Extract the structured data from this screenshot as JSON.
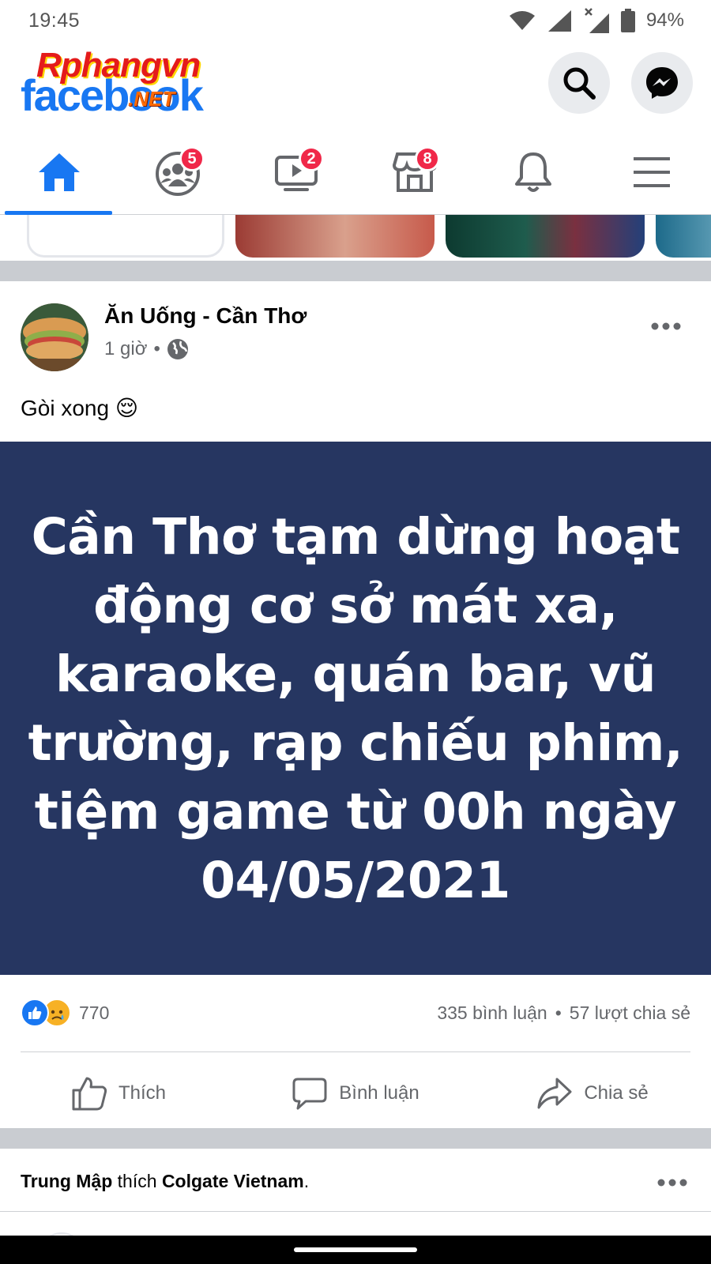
{
  "status_bar": {
    "time": "19:45",
    "battery": "94%"
  },
  "header": {
    "logo_text": "facebook",
    "watermark_text": "Rphangvn",
    "watermark_suffix": ".NET"
  },
  "tabs": [
    {
      "name": "home",
      "icon": "home-icon",
      "badge": ""
    },
    {
      "name": "groups",
      "icon": "groups-icon",
      "badge": "5"
    },
    {
      "name": "watch",
      "icon": "video-icon",
      "badge": "2"
    },
    {
      "name": "marketplace",
      "icon": "marketplace-icon",
      "badge": "8"
    },
    {
      "name": "notifications",
      "icon": "bell-icon",
      "badge": ""
    },
    {
      "name": "menu",
      "icon": "hamburger-icon",
      "badge": ""
    }
  ],
  "post": {
    "page_name": "Ăn Uống - Cần Thơ",
    "time": "1 giờ",
    "separator": "•",
    "caption": "Gòi xong 😌",
    "image_text": "Cần Thơ tạm dừng hoạt động cơ sở mát xa, karaoke, quán bar, vũ trường, rạp chiếu phim, tiệm game từ 00h ngày 04/05/2021",
    "image_bg_color": "#263661",
    "reaction_count": "770",
    "comments": "335 bình luận",
    "dot": "•",
    "shares": "57 lượt chia sẻ",
    "actions": {
      "like": "Thích",
      "comment": "Bình luận",
      "share": "Chia sẻ"
    }
  },
  "activity": {
    "actor": "Trung Mập",
    "verb": " thích ",
    "target": "Colgate Vietnam",
    "suffix": "."
  },
  "colors": {
    "accent": "#1877f2",
    "badge": "#f02849",
    "muted": "#65676b"
  }
}
